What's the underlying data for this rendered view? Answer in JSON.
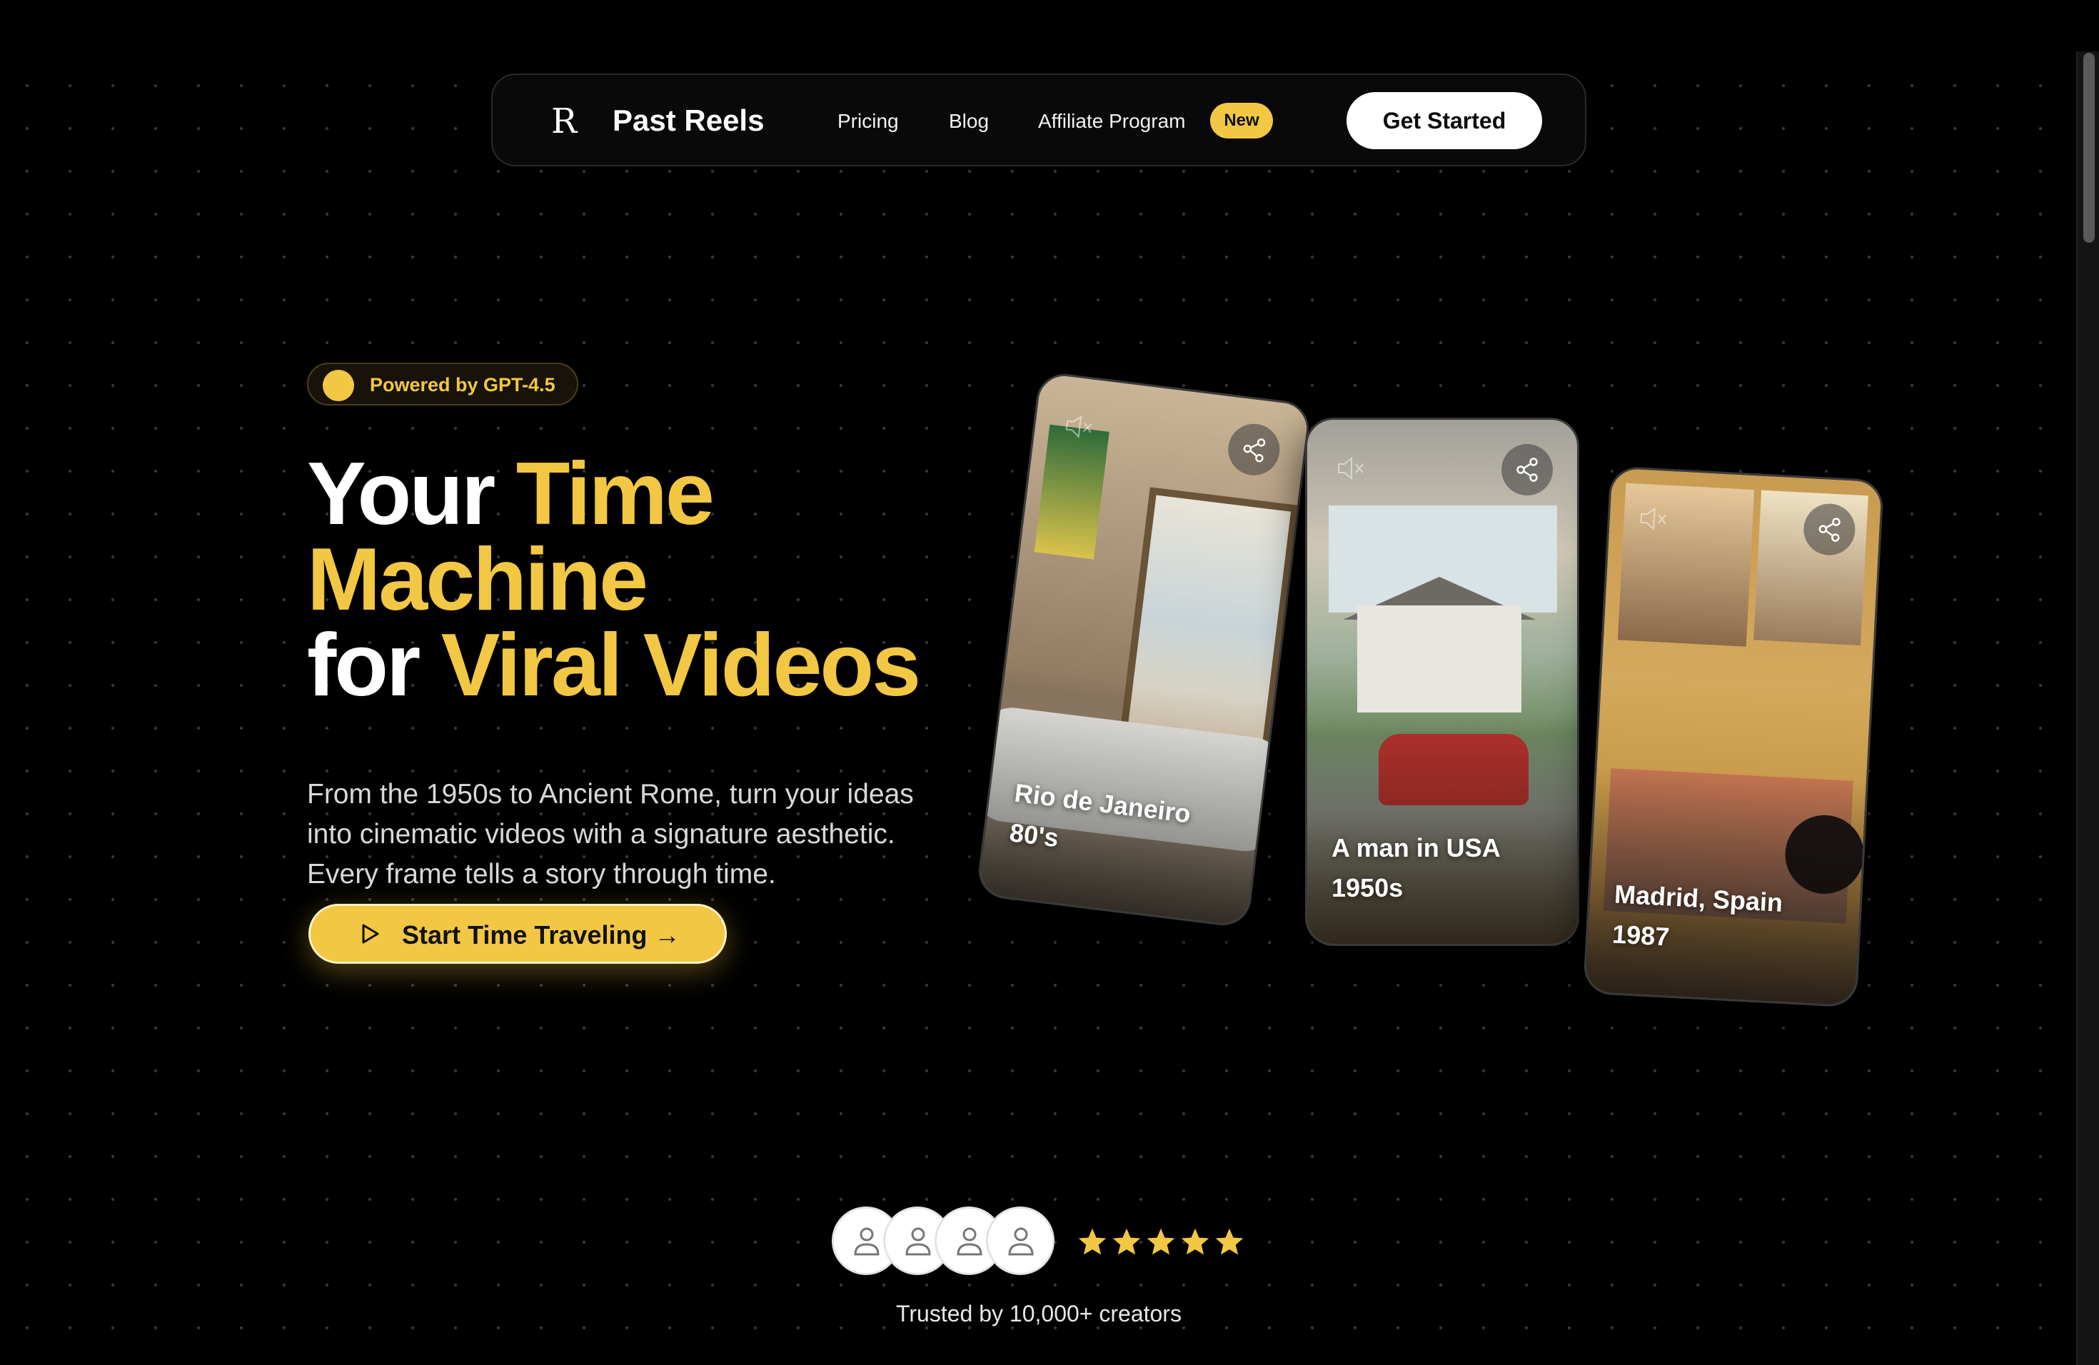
{
  "nav": {
    "brand_logo": "R",
    "brand_name": "Past Reels",
    "links": [
      "Pricing",
      "Blog",
      "Affiliate Program"
    ],
    "new_badge": "New",
    "cta": "Get Started"
  },
  "hero": {
    "badge": "Powered by GPT-4.5",
    "headline": {
      "line1_white": "Your ",
      "line1_yellow": "Time",
      "line2_yellow": "Machine",
      "line3_white": "for ",
      "line3_yellow": "Viral Videos"
    },
    "subcopy": "From the 1950s to Ancient Rome, turn your ideas into cinematic videos with a signature aesthetic. Every frame tells a story through time.",
    "cta": "Start Time Traveling →"
  },
  "cards": [
    {
      "caption_line1": "Rio de Janeiro",
      "caption_line2": "80's",
      "icons": [
        "mute-icon",
        "share-icon"
      ]
    },
    {
      "caption_line1": "A man in USA",
      "caption_line2": "1950s",
      "icons": [
        "mute-icon",
        "share-icon"
      ]
    },
    {
      "caption_line1": "Madrid, Spain",
      "caption_line2": "1987",
      "icons": [
        "mute-icon",
        "share-icon"
      ]
    }
  ],
  "social_proof": {
    "avatar_count": 4,
    "rating_stars": 5,
    "trusted_text": "Trusted by 10,000+ creators"
  },
  "colors": {
    "background": "#000000",
    "accent": "#f2c744",
    "text": "#ffffff",
    "muted_text": "#d8d8d8"
  }
}
